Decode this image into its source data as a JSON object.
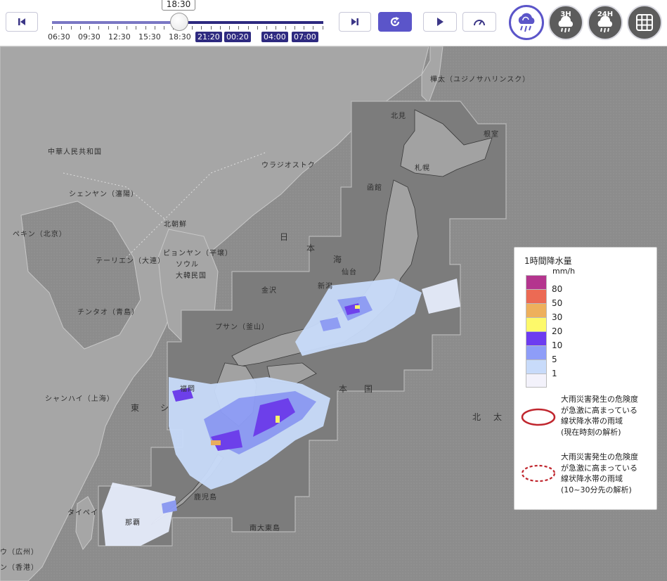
{
  "toolbar": {
    "current_time": "18:30",
    "time_labels_past": [
      "06:30",
      "09:30",
      "12:30",
      "15:30",
      "18:30"
    ],
    "time_labels_future": [
      "21:20",
      "00:20",
      "04:00",
      "07:00"
    ],
    "buttons": {
      "first": "skip-to-start-icon",
      "last": "skip-to-end-icon",
      "refresh": "refresh-icon",
      "play": "play-icon",
      "speed": "speedometer-icon"
    },
    "layer_buttons": {
      "rain_now": "cloud-rain-icon",
      "rain_3h": "3H",
      "rain_24h": "24H",
      "grid": "grid-icon"
    },
    "accent_color": "#5b55c9",
    "future_color": "#2e2a80"
  },
  "map": {
    "place_labels": {
      "china": "中華人民共和国",
      "vladivostok": "ウラジオストク",
      "shenyang": "シェンヤン（瀋陽）",
      "beijing": "ペキン（北京）",
      "north_korea": "北朝鮮",
      "tianjin": "テーリエン（大連）",
      "pyongyang": "ピョンヤン（平壌）",
      "seoul": "ソウル",
      "south_korea": "大韓民国",
      "qingdao": "チンタオ（青島）",
      "busan": "プサン（釜山）",
      "shanghai": "シャンハイ（上海）",
      "taipei": "タイペイ",
      "guangzhou": "ウ（広州）",
      "hongkong": "ン（香港）",
      "sakhalin": "樺太（ユジノサハリンスク）",
      "wakkanai": "北見",
      "sapporo": "札幌",
      "hakodate": "函館",
      "nemuro": "根室",
      "sea_japan_1": "日",
      "sea_japan_2": "本",
      "sea_japan_3": "海",
      "east_china_1": "東",
      "east_china_2": "シ",
      "north_pacific_1": "北",
      "north_pacific_2": "太",
      "japan": "本　国",
      "sendai": "仙台",
      "niigata": "新潟",
      "kanazawa": "金沢",
      "fukuoka": "福岡",
      "kagoshima": "鹿児島",
      "naha": "那覇",
      "minami_daito": "南大東島"
    }
  },
  "legend": {
    "title": "1時間降水量",
    "unit": "mm/h",
    "levels": [
      {
        "label": "80",
        "color": "#b4358e"
      },
      {
        "label": "50",
        "color": "#ec6a54"
      },
      {
        "label": "30",
        "color": "#eeb05c"
      },
      {
        "label": "20",
        "color": "#fdf96a"
      },
      {
        "label": "10",
        "color": "#6d3cf0"
      },
      {
        "label": "5",
        "color": "#8e9df8"
      },
      {
        "label": "1",
        "color": "#c8dbfa"
      },
      {
        "label": "",
        "color": "#f3f2fb"
      }
    ],
    "band_current": [
      "大雨災害発生の危険度",
      "が急激に高まっている",
      "線状降水帯の雨域",
      "(現在時刻の解析)"
    ],
    "band_forecast": [
      "大雨災害発生の危険度",
      "が急激に高まっている",
      "線状降水帯の雨域",
      "(10~30分先の解析)"
    ],
    "band_color": "#c0262e"
  }
}
